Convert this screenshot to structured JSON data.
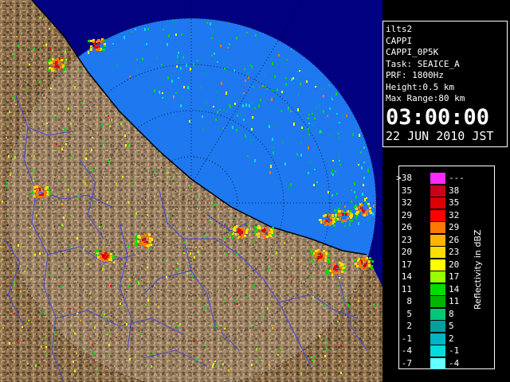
{
  "info": {
    "site": "ilts2",
    "product": "CAPPI",
    "product_name": "CAPPI_0P5K",
    "task": "Task: SEAICE_A",
    "prf": "PRF: 1800Hz",
    "height": "Height:0.5 km",
    "max_range": "Max Range:80 km",
    "time": "03:00:00",
    "date": "22 JUN 2010 JST"
  },
  "legend": {
    "title": "Reflectivity in dBZ",
    "rows": [
      {
        "lo": ">38",
        "hi": "---",
        "color": "#ff28ff"
      },
      {
        "lo": "35",
        "hi": "38",
        "color": "#c8001c"
      },
      {
        "lo": "32",
        "hi": "35",
        "color": "#dc0000"
      },
      {
        "lo": "29",
        "hi": "32",
        "color": "#ff0000"
      },
      {
        "lo": "26",
        "hi": "29",
        "color": "#ff7800"
      },
      {
        "lo": "23",
        "hi": "26",
        "color": "#ffb400"
      },
      {
        "lo": "20",
        "hi": "23",
        "color": "#ffdc00"
      },
      {
        "lo": "17",
        "hi": "20",
        "color": "#ffff00"
      },
      {
        "lo": "14",
        "hi": "17",
        "color": "#96ff00"
      },
      {
        "lo": "11",
        "hi": "14",
        "color": "#00dc00"
      },
      {
        "lo": "8",
        "hi": "11",
        "color": "#00b400"
      },
      {
        "lo": "5",
        "hi": "8",
        "color": "#00c878"
      },
      {
        "lo": "2",
        "hi": "5",
        "color": "#00a0a0"
      },
      {
        "lo": "-1",
        "hi": "2",
        "color": "#00b4c8"
      },
      {
        "lo": "-4",
        "hi": "-1",
        "color": "#00dcdc"
      },
      {
        "lo": "-7",
        "hi": "-4",
        "color": "#64ffff"
      }
    ]
  },
  "colors": {
    "sea_echo": "#1e78f0",
    "sea_outside": "#000080",
    "land": "#8c6e4b",
    "river": "#4646dc",
    "range_ring": "#000000"
  }
}
